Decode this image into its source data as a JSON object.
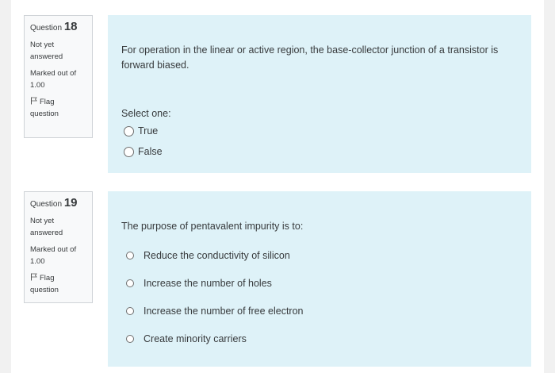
{
  "questions": [
    {
      "label": "Question",
      "number": "18",
      "state_line1": "Not yet",
      "state_line2": "answered",
      "grade_line1": "Marked out of",
      "grade_line2": "1.00",
      "flag_line1": "Flag",
      "flag_line2": "question",
      "text_line1": "For operation in the linear or active region, the base-collector junction of a transistor is",
      "text_line2": "forward biased.",
      "prompt": "Select one:",
      "options": [
        "True",
        "False"
      ]
    },
    {
      "label": "Question",
      "number": "19",
      "state_line1": "Not yet",
      "state_line2": "answered",
      "grade_line1": "Marked out of",
      "grade_line2": "1.00",
      "flag_line1": "Flag",
      "flag_line2": "question",
      "text_line1": "The purpose of pentavalent impurity is to:",
      "options": [
        "Reduce the conductivity of silicon",
        "Increase the number of holes",
        "Increase the number of free electron",
        "Create minority carriers"
      ]
    }
  ],
  "icons": {
    "flag": "flag-icon",
    "radio": "radio-button-icon"
  },
  "colors": {
    "content_bg": "#def2f8",
    "info_bg": "#f8f9fa",
    "info_border": "#cfd3d7",
    "page_edge": "#f1f1f1"
  }
}
